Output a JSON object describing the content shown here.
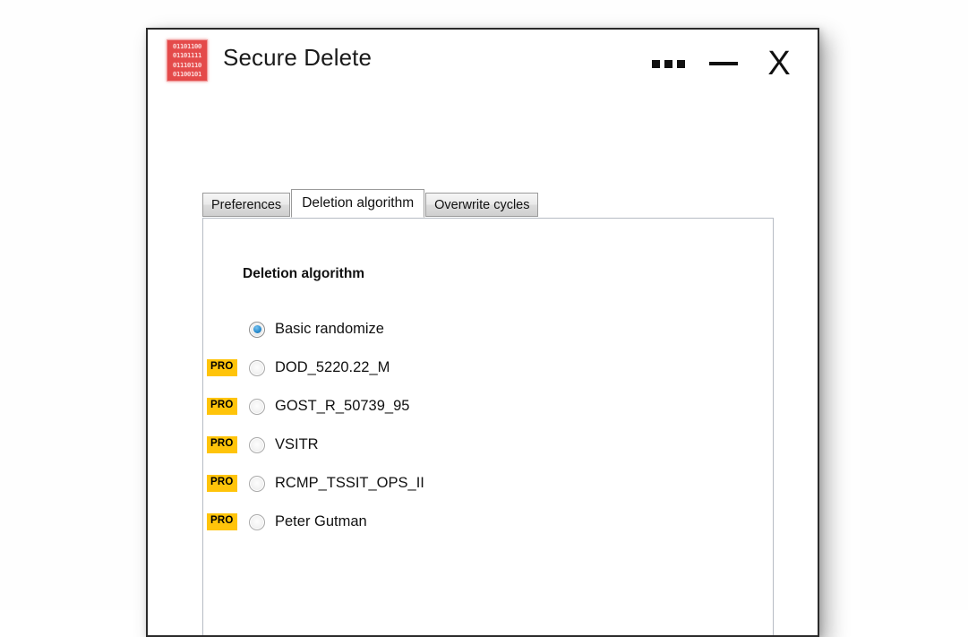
{
  "window": {
    "title": "Secure Delete",
    "icon_name": "binary-app-icon",
    "icon_binary_rows": [
      "01101100",
      "01101111",
      "01110110",
      "01100101"
    ],
    "controls": {
      "menu_label": "▪▪▪",
      "minimize_label": "—",
      "close_label": "X"
    }
  },
  "tabs": [
    {
      "label": "Preferences",
      "active": false
    },
    {
      "label": "Deletion algorithm",
      "active": true
    },
    {
      "label": "Overwrite cycles",
      "active": false
    }
  ],
  "panel": {
    "heading": "Deletion algorithm",
    "pro_badge_label": "PRO",
    "pro_badge_color": "#ffc40a",
    "accent_color": "#2d8fd0",
    "algorithms": [
      {
        "label": "Basic randomize",
        "selected": true,
        "pro": false
      },
      {
        "label": "DOD_5220.22_M",
        "selected": false,
        "pro": true
      },
      {
        "label": "GOST_R_50739_95",
        "selected": false,
        "pro": true
      },
      {
        "label": "VSITR",
        "selected": false,
        "pro": true
      },
      {
        "label": "RCMP_TSSIT_OPS_II",
        "selected": false,
        "pro": true
      },
      {
        "label": "Peter Gutman",
        "selected": false,
        "pro": true
      }
    ]
  }
}
